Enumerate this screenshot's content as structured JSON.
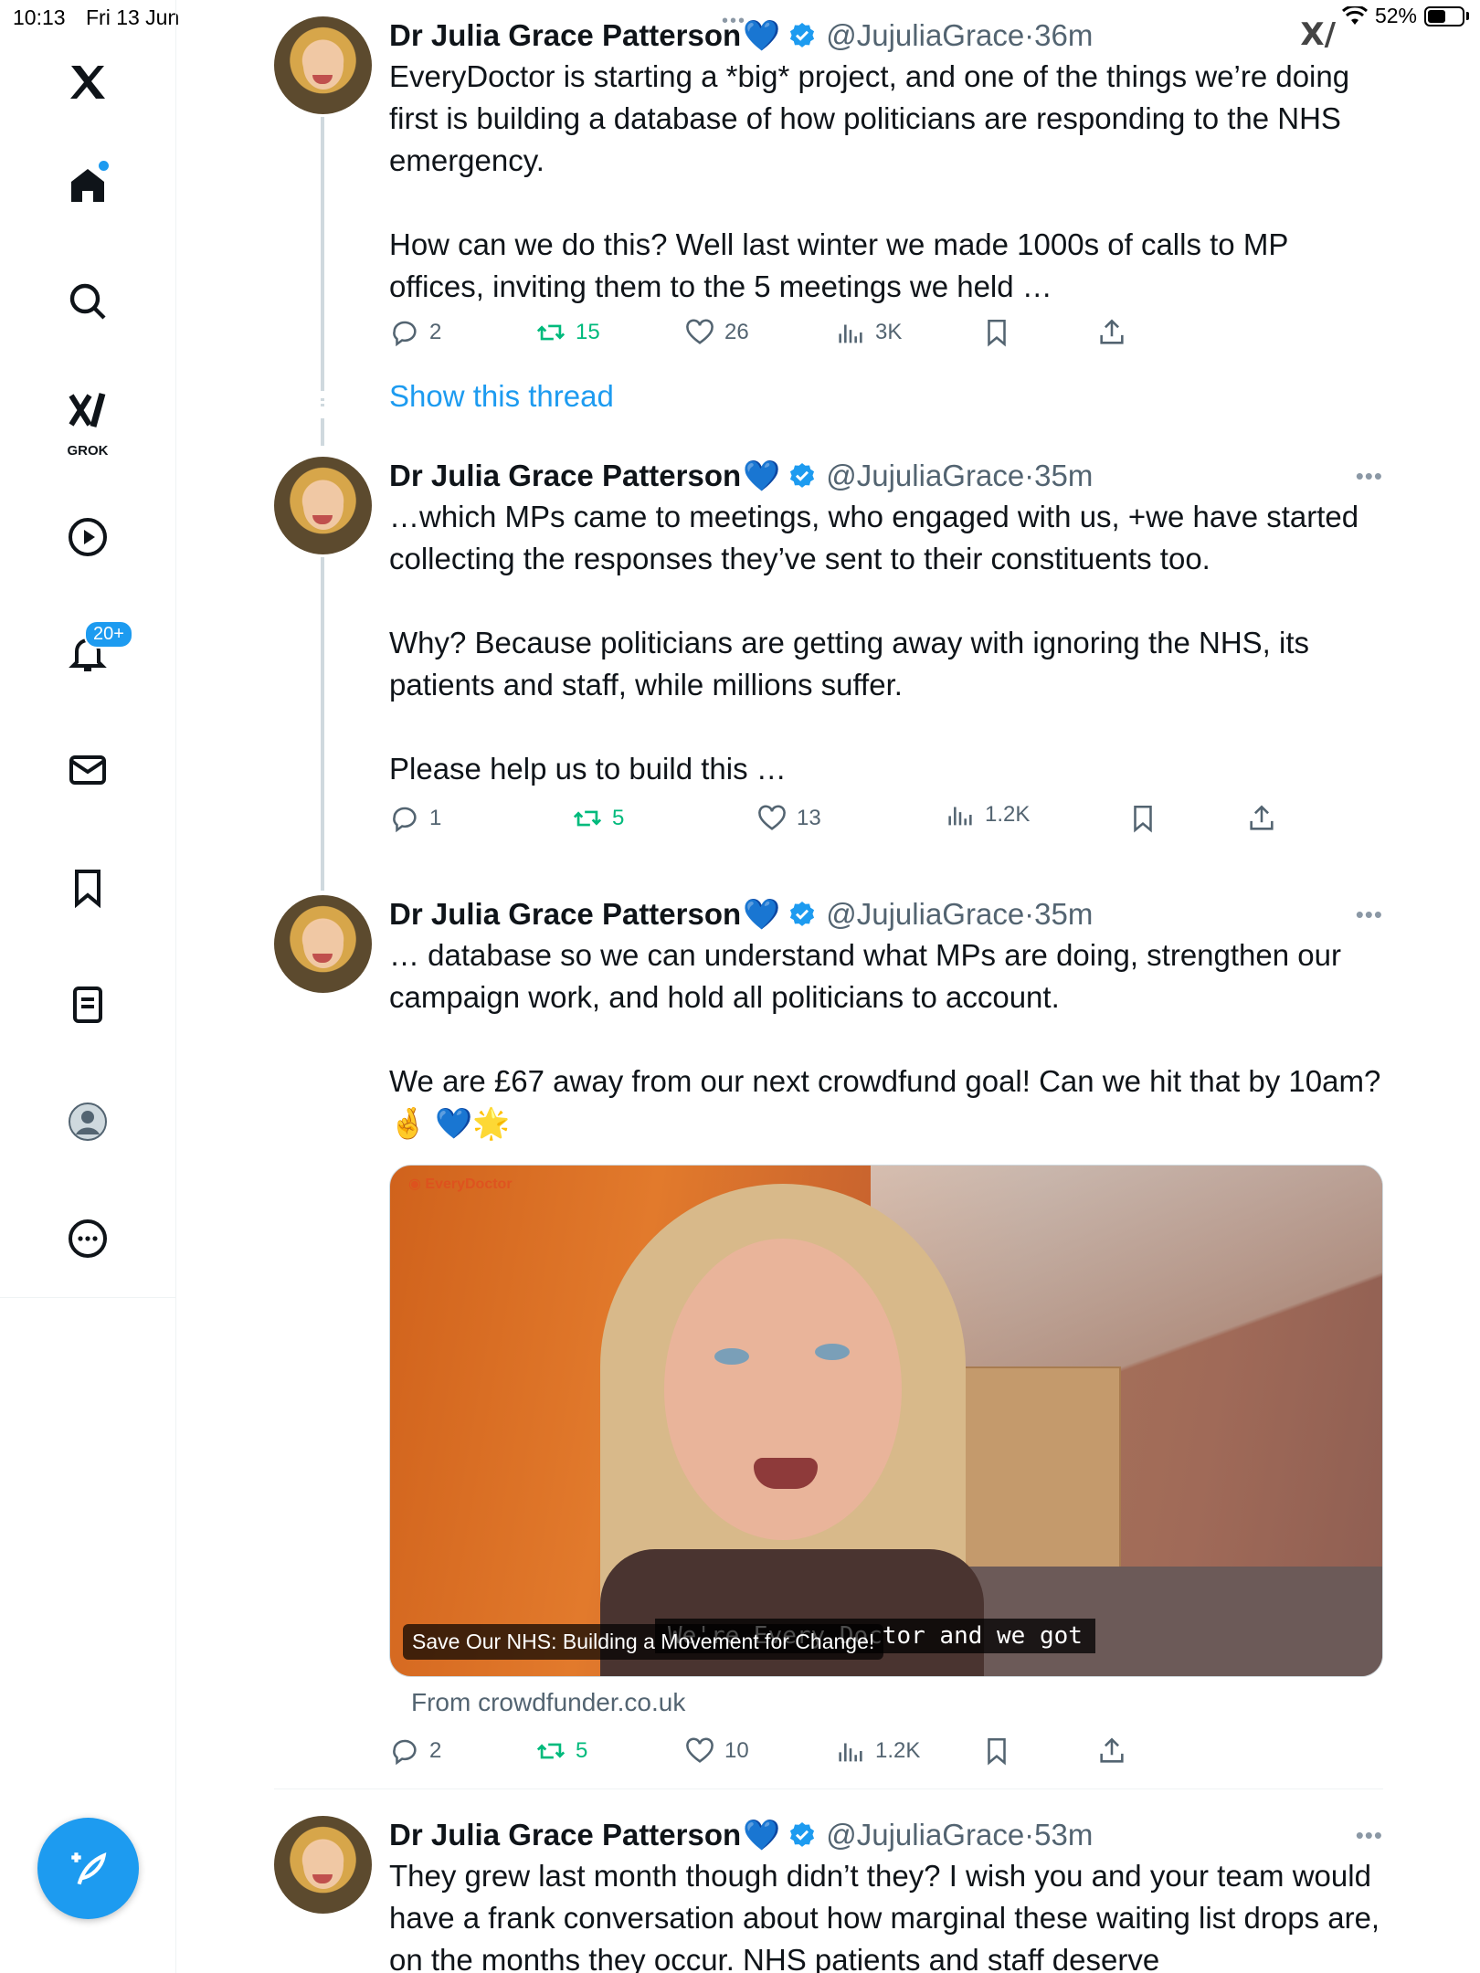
{
  "status_bar": {
    "time": "10:13",
    "date": "Fri 13 Jun",
    "battery": "52%",
    "battery_level": 0.52
  },
  "sidebar": {
    "grok_label": "GROK",
    "notifications_badge": "20+",
    "items": [
      "x-logo",
      "home-icon",
      "search-icon",
      "grok-icon",
      "video-icon",
      "bell-icon",
      "mail-icon",
      "bookmark-icon",
      "lists-icon",
      "profile-icon",
      "more-icon"
    ]
  },
  "tweets": [
    {
      "author": "Dr Julia Grace Patterson",
      "handle": "@JujuliaGrace",
      "time": "36m",
      "text": "EveryDoctor is starting a *big* project, and one of the things we’re doing first is building a database of how politicians are responding to the NHS emergency.\n\nHow can we do this? Well last winter we made 1000s of calls to MP offices, inviting them to the 5 meetings we held …",
      "replies": "2",
      "retweets": "15",
      "likes": "26",
      "views": "3K",
      "show_thread": "Show this thread"
    },
    {
      "author": "Dr Julia Grace Patterson",
      "handle": "@JujuliaGrace",
      "time": "35m",
      "text": "…which MPs came to meetings, who engaged with us, +we have started collecting the responses they’ve sent to their constituents too.\n\nWhy? Because politicians are getting away with ignoring the NHS, its patients and staff, while millions suffer.\n\nPlease help us to build this …",
      "replies": "1",
      "retweets": "5",
      "likes": "13",
      "views": "1.2K"
    },
    {
      "author": "Dr Julia Grace Patterson",
      "handle": "@JujuliaGrace",
      "time": "35m",
      "text": "… database so we can understand what MPs are doing, strengthen our campaign work, and hold all politicians to account.\n\nWe are £67 away from our next crowdfund goal! Can we hit that by 10am? 🤞 💙🌟",
      "card_caption": "Save Our NHS: Building a Movement for Change!",
      "card_subtitle": "We're Every Doctor and we got",
      "card_source": "From crowdfunder.co.uk",
      "replies": "2",
      "retweets": "5",
      "likes": "10",
      "views": "1.2K"
    },
    {
      "author": "Dr Julia Grace Patterson",
      "handle": "@JujuliaGrace",
      "time": "53m",
      "text": "They grew last month though didn’t they? I wish you and your team would have a frank conversation about how marginal these waiting list drops are, on the months they occur. NHS patients and staff deserve"
    }
  ],
  "separator_dot": "·",
  "heart": "💙"
}
